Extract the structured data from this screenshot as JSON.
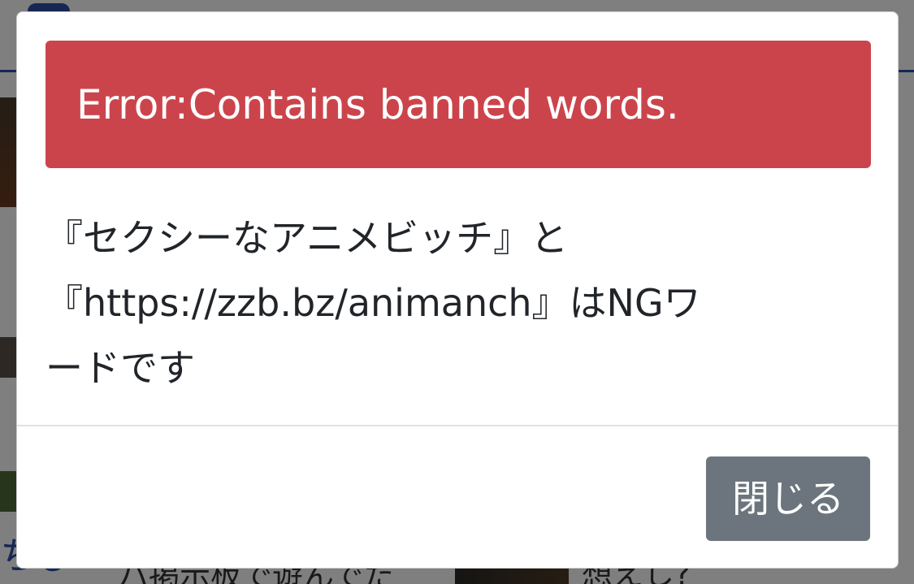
{
  "background": {
    "left_snippet": "ハ掲示板で遊んでた",
    "right_snippet": "想えし?",
    "link_snippet": "ちびT"
  },
  "modal": {
    "alert_text": "Error:Contains banned words.",
    "message_lines": [
      "『セクシーなアニメビッチ』と",
      "『https://zzb.bz/animanch』はNGワ",
      "ードです"
    ],
    "close_label": "閉じる"
  },
  "colors": {
    "alert_bg": "#cc444b",
    "button_bg": "#6c757d",
    "brand": "#2c4fa8"
  }
}
